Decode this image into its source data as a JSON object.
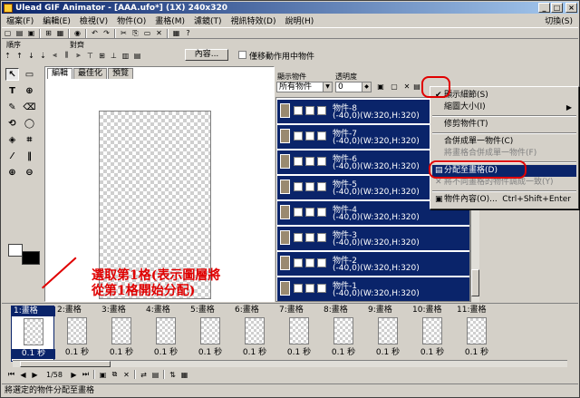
{
  "window": {
    "title": "Ulead GIF Animator - [AAA.ufo*] (1X) 240x320"
  },
  "menu": {
    "items": [
      "檔案(F)",
      "編輯(E)",
      "檢視(V)",
      "物件(O)",
      "畫格(M)",
      "濾鏡(T)",
      "視訊特效(D)",
      "說明(H)"
    ],
    "switch": "切換(S)"
  },
  "toolbar2": {
    "group1": "順序",
    "group2": "對齊",
    "properties_button": "內容...",
    "checkbox_label": "僅移動作用中物件"
  },
  "editor": {
    "tabs": [
      "編輯",
      "最佳化",
      "預覽"
    ]
  },
  "object_manager": {
    "show_label": "顯示物件",
    "show_value": "所有物件",
    "opacity_label": "透明度",
    "opacity_value": "0",
    "objects": [
      {
        "name": "物件-8",
        "info": "(-40,0)(W:320,H:320)"
      },
      {
        "name": "物件-7",
        "info": "(-40,0)(W:320,H:320)"
      },
      {
        "name": "物件-6",
        "info": "(-40,0)(W:320,H:320)"
      },
      {
        "name": "物件-5",
        "info": "(-40,0)(W:320,H:320)"
      },
      {
        "name": "物件-4",
        "info": "(-40,0)(W:320,H:320)"
      },
      {
        "name": "物件-3",
        "info": "(-40,0)(W:320,H:320)"
      },
      {
        "name": "物件-2",
        "info": "(-40,0)(W:320,H:320)"
      },
      {
        "name": "物件-1",
        "info": "(-40,0)(W:320,H:320)"
      }
    ]
  },
  "context_menu": {
    "items": [
      {
        "label": "顯示細節(S)",
        "checked": true
      },
      {
        "label": "縮圖大小(I)",
        "submenu": true
      },
      {
        "label": "修剪物件(T)"
      },
      {
        "label": "合併成單一物件(C)"
      },
      {
        "label": "將畫格合併成單一物件(F)",
        "disabled": true
      },
      {
        "label": "分配至畫格(D)",
        "highlighted": true
      },
      {
        "label": "將不同畫格的物件調成一致(Y)",
        "disabled": true
      },
      {
        "label": "物件內容(O)...",
        "shortcut": "Ctrl+Shift+Enter"
      }
    ]
  },
  "annotation": {
    "line1": "選取第1格(表示圖層將",
    "line2": "從第1格開始分配)"
  },
  "frames": [
    {
      "label": "1:畫格",
      "duration": "0.1 秒"
    },
    {
      "label": "2:畫格",
      "duration": "0.1 秒"
    },
    {
      "label": "3:畫格",
      "duration": "0.1 秒"
    },
    {
      "label": "4:畫格",
      "duration": "0.1 秒"
    },
    {
      "label": "5:畫格",
      "duration": "0.1 秒"
    },
    {
      "label": "6:畫格",
      "duration": "0.1 秒"
    },
    {
      "label": "7:畫格",
      "duration": "0.1 秒"
    },
    {
      "label": "8:畫格",
      "duration": "0.1 秒"
    },
    {
      "label": "9:畫格",
      "duration": "0.1 秒"
    },
    {
      "label": "10:畫格",
      "duration": "0.1 秒"
    },
    {
      "label": "11:畫格",
      "duration": "0.1 秒"
    }
  ],
  "controls": {
    "frame_counter": "1/58"
  },
  "status": {
    "text": "將選定的物件分配至畫格"
  },
  "colors": {
    "selection": "#0a246a",
    "annotation": "#e00000",
    "chrome": "#d4d0c8"
  }
}
